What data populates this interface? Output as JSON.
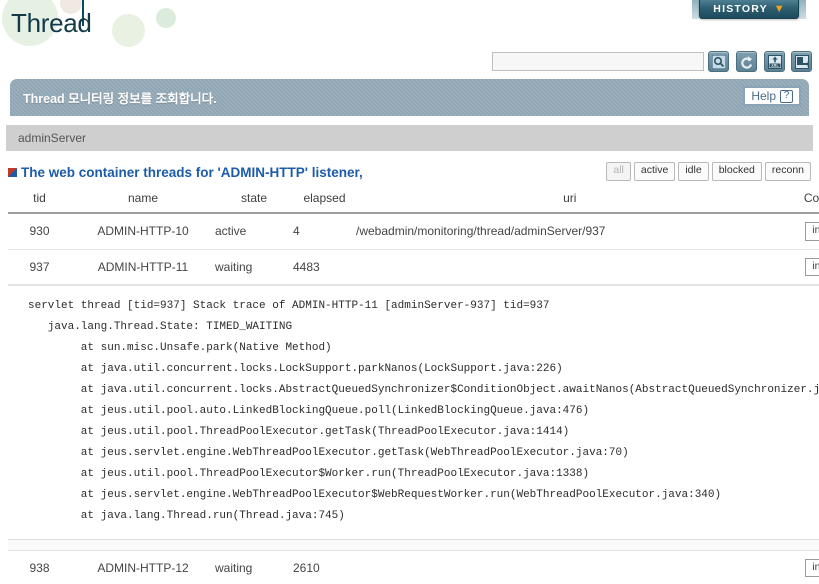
{
  "header": {
    "page_title": "Thread",
    "history_label": "HISTORY",
    "history_chevron_icon": "chevron-down-icon"
  },
  "search": {
    "value": "",
    "placeholder": "",
    "buttons": [
      {
        "icon": "search-icon",
        "name": "search-button"
      },
      {
        "icon": "refresh-icon",
        "name": "refresh-button"
      },
      {
        "icon": "xml-export-icon",
        "name": "xml-export-button"
      },
      {
        "icon": "excel-export-icon",
        "name": "excel-export-button"
      }
    ]
  },
  "info_bar": {
    "message": "Thread 모니터링 정보를 조회합니다.",
    "help_label": "Help",
    "help_icon": "question-mark-icon"
  },
  "server": {
    "name": "adminServer"
  },
  "section": {
    "bullet_icon": "square-bullet-icon",
    "title": "The web container threads for 'ADMIN-HTTP' listener,",
    "filters": [
      {
        "label": "all",
        "disabled": true
      },
      {
        "label": "active",
        "disabled": false
      },
      {
        "label": "idle",
        "disabled": false
      },
      {
        "label": "blocked",
        "disabled": false
      },
      {
        "label": "reconn",
        "disabled": false
      }
    ]
  },
  "table": {
    "columns": [
      "tid",
      "name",
      "state",
      "elapsed",
      "uri",
      "Command"
    ],
    "command_label": "interrupt",
    "rows": [
      {
        "tid": "930",
        "name": "ADMIN-HTTP-10",
        "state": "active",
        "elapsed": "4",
        "uri": "/webadmin/monitoring/thread/adminServer/937"
      },
      {
        "tid": "937",
        "name": "ADMIN-HTTP-11",
        "state": "waiting",
        "elapsed": "4483",
        "uri": ""
      },
      {
        "tid": "938",
        "name": "ADMIN-HTTP-12",
        "state": "waiting",
        "elapsed": "2610",
        "uri": ""
      }
    ]
  },
  "stack_trace": {
    "lines": [
      "servlet thread [tid=937] Stack trace of ADMIN-HTTP-11 [adminServer-937] tid=937",
      "   java.lang.Thread.State: TIMED_WAITING",
      "        at sun.misc.Unsafe.park(Native Method)",
      "        at java.util.concurrent.locks.LockSupport.parkNanos(LockSupport.java:226)",
      "        at java.util.concurrent.locks.AbstractQueuedSynchronizer$ConditionObject.awaitNanos(AbstractQueuedSynchronizer.java:2082)",
      "        at jeus.util.pool.auto.LinkedBlockingQueue.poll(LinkedBlockingQueue.java:476)",
      "        at jeus.util.pool.ThreadPoolExecutor.getTask(ThreadPoolExecutor.java:1414)",
      "        at jeus.servlet.engine.WebThreadPoolExecutor.getTask(WebThreadPoolExecutor.java:70)",
      "        at jeus.util.pool.ThreadPoolExecutor$Worker.run(ThreadPoolExecutor.java:1338)",
      "        at jeus.servlet.engine.WebThreadPoolExecutor$WebRequestWorker.run(WebThreadPoolExecutor.java:340)",
      "        at java.lang.Thread.run(Thread.java:745)"
    ]
  },
  "colors": {
    "accent_blue": "#1c5ca8",
    "info_bar": "#8fa4b3",
    "history_tab": "#2f5f72",
    "history_chevron": "#f2a21c",
    "server_bar": "#cfcfcf"
  }
}
